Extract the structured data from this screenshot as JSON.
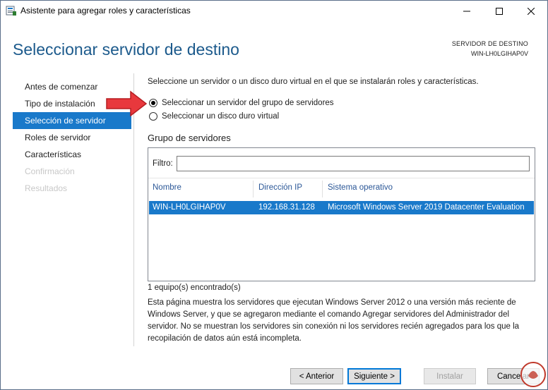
{
  "window": {
    "title": "Asistente para agregar roles y características"
  },
  "header": {
    "title": "Seleccionar servidor de destino",
    "dest_label": "SERVIDOR DE DESTINO",
    "dest_server": "WIN-LH0LGIHAP0V"
  },
  "nav": {
    "items": [
      {
        "label": "Antes de comenzar",
        "state": "normal"
      },
      {
        "label": "Tipo de instalación",
        "state": "normal"
      },
      {
        "label": "Selección de servidor",
        "state": "active"
      },
      {
        "label": "Roles de servidor",
        "state": "normal"
      },
      {
        "label": "Características",
        "state": "normal"
      },
      {
        "label": "Confirmación",
        "state": "disabled"
      },
      {
        "label": "Resultados",
        "state": "disabled"
      }
    ]
  },
  "content": {
    "intro": "Seleccione un servidor o un disco duro virtual en el que se instalarán roles y características.",
    "radio_server": "Seleccionar un servidor del grupo de servidores",
    "radio_vhd": "Seleccionar un disco duro virtual",
    "group_label": "Grupo de servidores",
    "filter_label": "Filtro:",
    "filter_value": "",
    "columns": [
      "Nombre",
      "Dirección IP",
      "Sistema operativo"
    ],
    "rows": [
      {
        "name": "WIN-LH0LGIHAP0V",
        "ip": "192.168.31.128",
        "os": "Microsoft Windows Server 2019 Datacenter Evaluation"
      }
    ],
    "count": "1 equipo(s) encontrado(s)",
    "description": "Esta página muestra los servidores que ejecutan Windows Server 2012 o una versión más reciente de Windows Server, y que se agregaron mediante el comando Agregar servidores del Administrador del servidor. No se muestran los servidores sin conexión ni los servidores recién agregados para los que la recopilación de datos aún está incompleta."
  },
  "footer": {
    "prev": "< Anterior",
    "next": "Siguiente >",
    "install": "Instalar",
    "cancel": "Cancelar"
  },
  "colors": {
    "accent": "#1979ca",
    "title": "#1c5a8c",
    "arrow": "#e8383d"
  }
}
